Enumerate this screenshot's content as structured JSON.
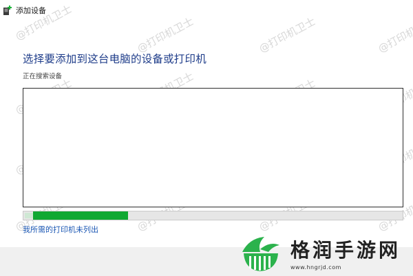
{
  "window": {
    "title": "添加设备",
    "icon": "add-device-icon"
  },
  "heading": "选择要添加到这台电脑的设备或打印机",
  "status": "正在搜索设备",
  "device_list": [],
  "progress": {
    "value": 0.25,
    "color": "#0fa832"
  },
  "link_text": "我所需的打印机未列出",
  "watermark": "@打印机卫士",
  "brand": {
    "name": "格润手游网",
    "url": "www.hngrjd.com"
  }
}
